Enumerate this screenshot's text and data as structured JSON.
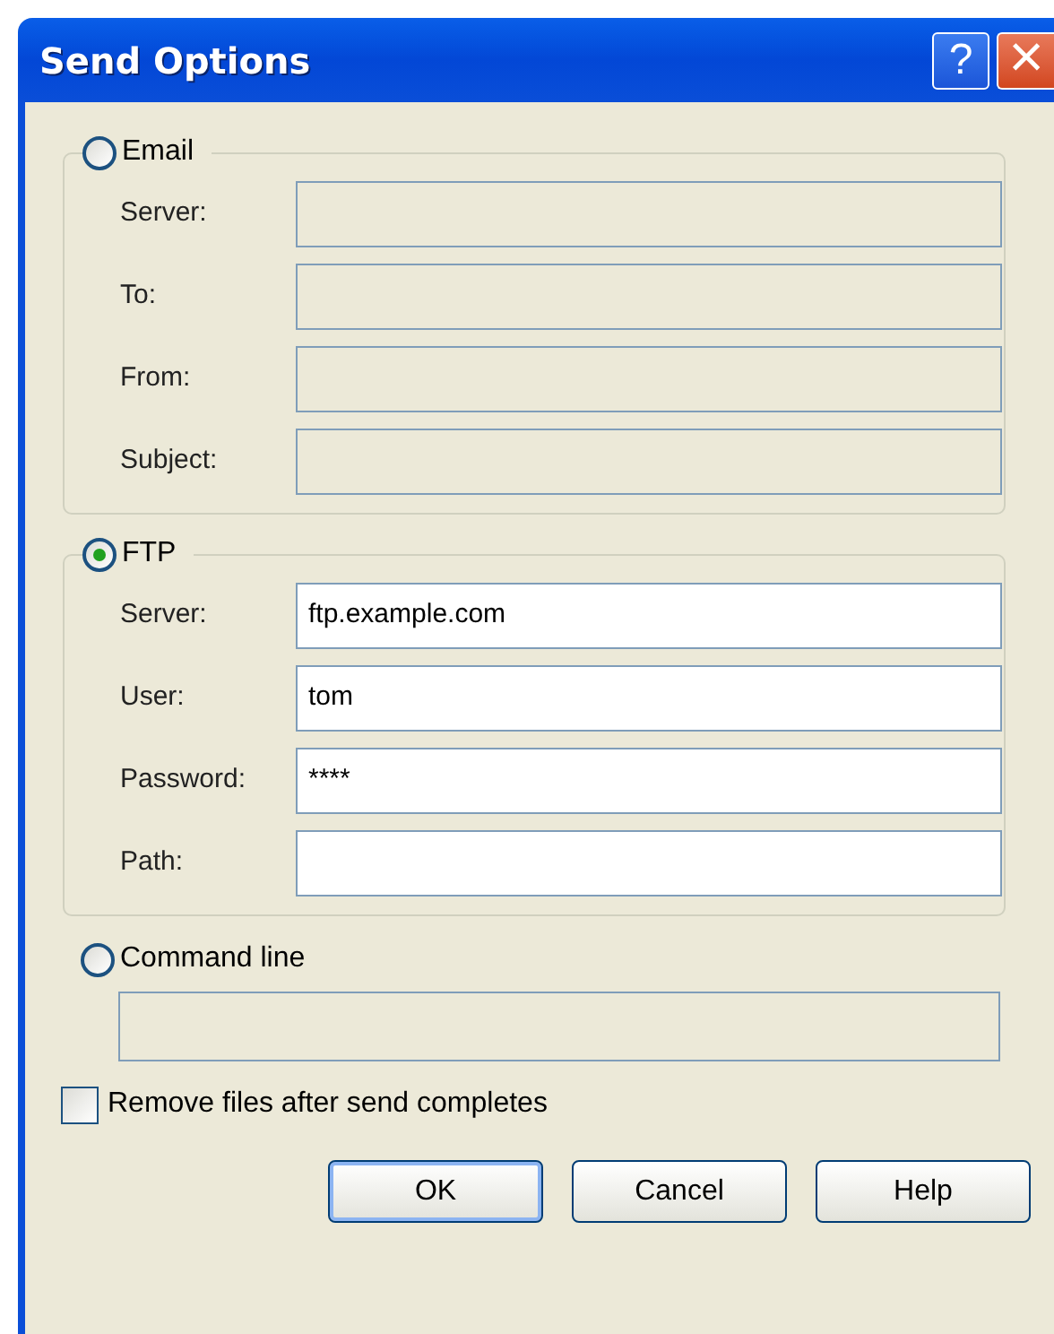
{
  "window": {
    "title": "Send Options",
    "help_button": "?",
    "close_button": "×"
  },
  "groups": [
    {
      "label": "Email",
      "selected": false,
      "fields": [
        {
          "label": "Server:",
          "disabled": true
        },
        {
          "label": "To:",
          "disabled": true
        },
        {
          "label": "From:",
          "disabled": true
        },
        {
          "label": "Subject:",
          "disabled": true
        }
      ]
    },
    {
      "label": "FTP",
      "selected": true,
      "fields": [
        {
          "label": "Server:",
          "value": "ftp.example.com",
          "disabled": false
        },
        {
          "label": "User:",
          "value": "tom",
          "disabled": false
        },
        {
          "label": "Password:",
          "value": "****",
          "disabled": false
        },
        {
          "label": "Path:",
          "disabled": false
        }
      ]
    }
  ],
  "command_line": {
    "label": "Command line",
    "selected": false,
    "disabled": true
  },
  "remove_files": {
    "label": "Remove files after send completes",
    "checked": false
  },
  "buttons": [
    {
      "label": "OK",
      "default": true
    },
    {
      "label": "Cancel",
      "default": false
    },
    {
      "label": "Help",
      "default": false
    }
  ]
}
